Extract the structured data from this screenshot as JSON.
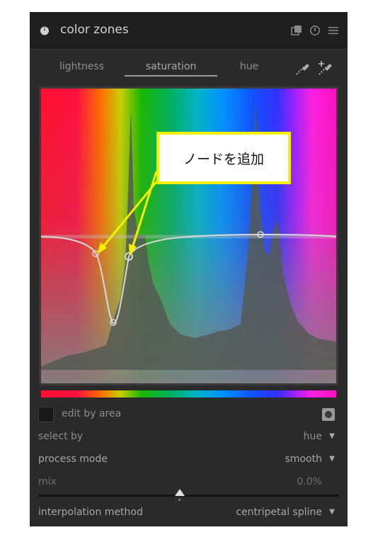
{
  "module": {
    "title": "color zones",
    "icons": {
      "power": "power-icon",
      "multi_instance": "multi-instance-icon",
      "reset": "reset-icon",
      "presets": "presets-menu-icon"
    }
  },
  "tabs": [
    {
      "label": "lightness",
      "active": false
    },
    {
      "label": "saturation",
      "active": true
    },
    {
      "label": "hue",
      "active": false
    }
  ],
  "pickers": [
    "color-picker-icon",
    "color-picker-set-values-icon"
  ],
  "annotation": {
    "text": "ノードを追加",
    "border_color": "#f5f000",
    "arrow_color": "#f5f000"
  },
  "controls": {
    "edit_by_area": {
      "label": "edit by area",
      "checked": false
    },
    "select_by": {
      "label": "select by",
      "value": "hue"
    },
    "process_mode": {
      "label": "process mode",
      "value": "smooth"
    },
    "mix": {
      "label": "mix",
      "value": "0.0%",
      "fraction": 0.5
    },
    "interpolation_method": {
      "label": "interpolation method",
      "value": "centripetal spline"
    }
  },
  "colors": {
    "panel_bg": "#2a2a2a",
    "header_bg": "#1f1f1f",
    "text": "#8c8c8c"
  }
}
